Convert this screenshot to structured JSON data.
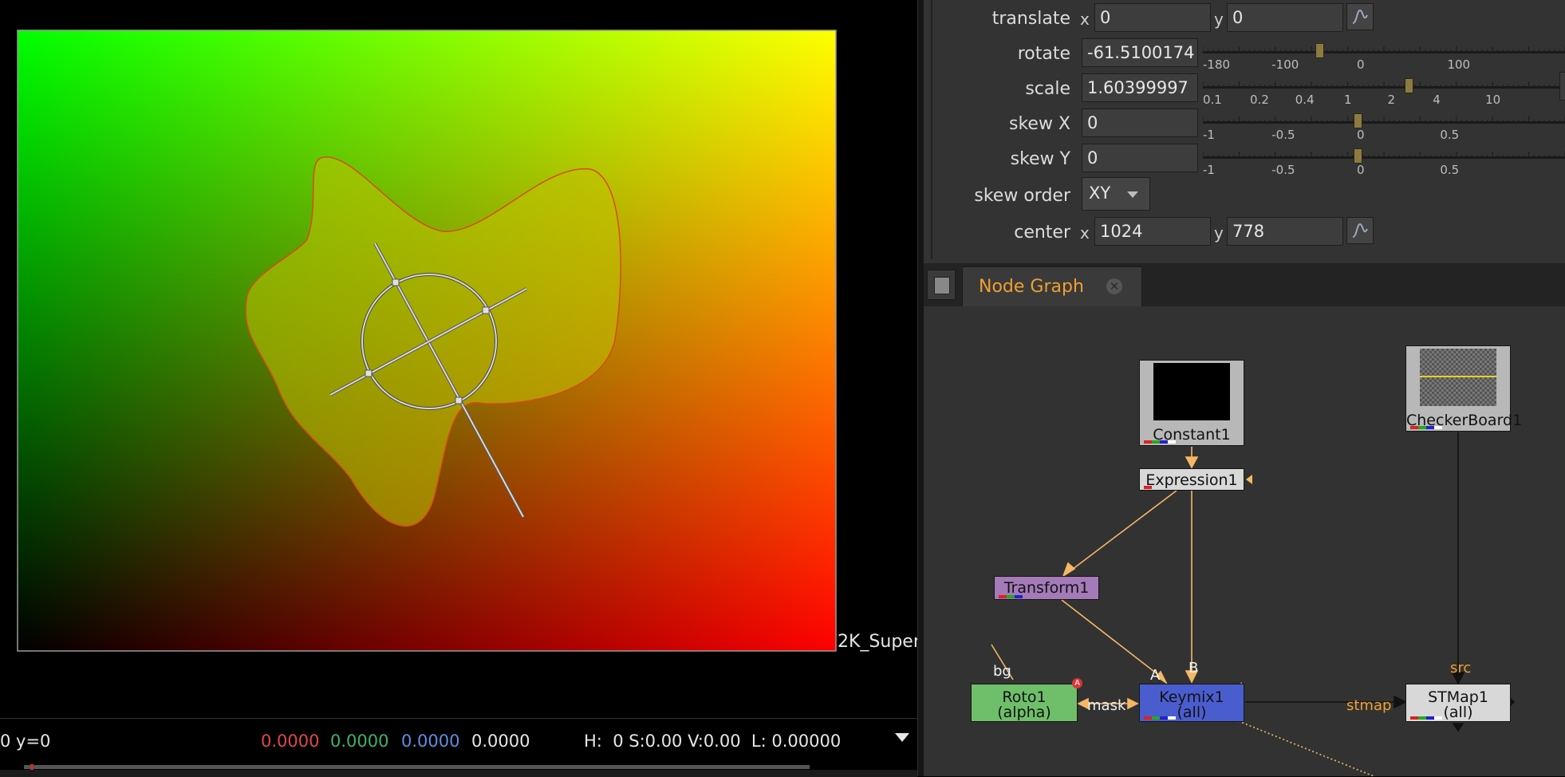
{
  "viewer": {
    "format_label": "2K_Super",
    "status": {
      "coords": "0 y=0",
      "r": "0.0000",
      "g": "0.0000",
      "b": "0.0000",
      "a": "0.0000",
      "hsvl": "H:  0 S:0.00 V:0.00  L: 0.00000"
    }
  },
  "properties": {
    "translate": {
      "label": "translate",
      "x_label": "x",
      "x": "0",
      "y_label": "y",
      "y": "0"
    },
    "rotate": {
      "label": "rotate",
      "value": "-61.5100174",
      "ticks": [
        "-180",
        "-100",
        "0",
        "100"
      ],
      "level_deg": -61.51
    },
    "scale": {
      "label": "scale",
      "value": "1.60399997",
      "ticks": [
        "0.1",
        "0.2",
        "0.4",
        "1",
        "2",
        "4",
        "10"
      ],
      "level": 1.604
    },
    "skew_x": {
      "label": "skew X",
      "value": "0",
      "ticks": [
        "-1",
        "-0.5",
        "0",
        "0.5"
      ],
      "level": 0
    },
    "skew_y": {
      "label": "skew Y",
      "value": "0",
      "ticks": [
        "-1",
        "-0.5",
        "0",
        "0.5"
      ],
      "level": 0
    },
    "skew_order": {
      "label": "skew order",
      "value": "XY"
    },
    "center": {
      "label": "center",
      "x_label": "x",
      "x": "1024",
      "y_label": "y",
      "y": "778"
    }
  },
  "node_graph": {
    "tab_title": "Node Graph",
    "close_glyph": "✕",
    "nodes": {
      "constant": "Constant1",
      "checkerboard": "CheckerBoard1",
      "expression": "Expression1",
      "transform": "Transform1",
      "roto": {
        "name": "Roto1",
        "sub": "(alpha)"
      },
      "keymix": {
        "name": "Keymix1",
        "sub": "(all)"
      },
      "stmap": {
        "name": "STMap1",
        "sub": "(all)"
      }
    },
    "inputs": {
      "bg": "bg",
      "a": "A",
      "b": "B",
      "mask": "mask",
      "src": "src",
      "stmap": "stmap"
    },
    "roto_badge": "A"
  },
  "colors": {
    "pipe_orange": "#f5b766",
    "node_orange_text": "#f0a030",
    "roto_green": "#6fbf6a",
    "keymix_blue": "#4a5dcf",
    "transform_purple": "#a47ab8",
    "status_red": "#e04848",
    "status_green": "#3fb36a",
    "status_blue": "#5d8fe0"
  }
}
